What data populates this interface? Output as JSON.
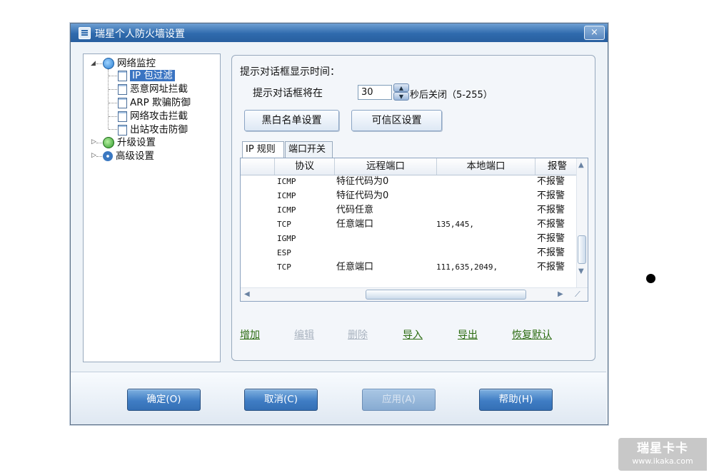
{
  "window": {
    "title": "瑞星个人防火墙设置",
    "close_glyph": "×"
  },
  "tree": {
    "root": "网络监控",
    "children": [
      "IP 包过滤",
      "恶意网址拦截",
      "ARP 欺骗防御",
      "网络攻击拦截",
      "出站攻击防御"
    ],
    "upgrade": "升级设置",
    "advanced": "高级设置",
    "selected_index": 0
  },
  "dialog_time": {
    "heading": "提示对话框显示时间：",
    "prefix": "提示对话框将在",
    "value": "30",
    "suffix": "秒后关闭（5-255）"
  },
  "buttons": {
    "blacklist": "黑白名单设置",
    "trusted_zone": "可信区设置"
  },
  "tabs": [
    "IP 规则",
    "端口开关"
  ],
  "table": {
    "columns": [
      "协议",
      "远程端口",
      "本地端口",
      "报警"
    ],
    "rows": [
      {
        "protocol": "ICMP",
        "remote": "特征代码为0",
        "local": "",
        "alarm": "不报警"
      },
      {
        "protocol": "ICMP",
        "remote": "特征代码为0",
        "local": "",
        "alarm": "不报警"
      },
      {
        "protocol": "ICMP",
        "remote": "代码任意",
        "local": "",
        "alarm": "不报警"
      },
      {
        "protocol": "TCP",
        "remote": "任意端口",
        "local": "135,445,",
        "alarm": "不报警"
      },
      {
        "protocol": "IGMP",
        "remote": "",
        "local": "",
        "alarm": "不报警"
      },
      {
        "protocol": "ESP",
        "remote": "",
        "local": "",
        "alarm": "不报警"
      },
      {
        "protocol": "TCP",
        "remote": "任意端口",
        "local": "111,635,2049,",
        "alarm": "不报警"
      }
    ]
  },
  "actions": {
    "add": "增加",
    "edit": "编辑",
    "delete": "删除",
    "import": "导入",
    "export": "导出",
    "restore": "恢复默认"
  },
  "dialog_buttons": {
    "ok": "确定(O)",
    "cancel": "取消(C)",
    "apply": "应用(A)",
    "help": "帮助(H)"
  },
  "watermark": {
    "title": "瑞星卡卡",
    "url": "www.ikaka.com"
  }
}
